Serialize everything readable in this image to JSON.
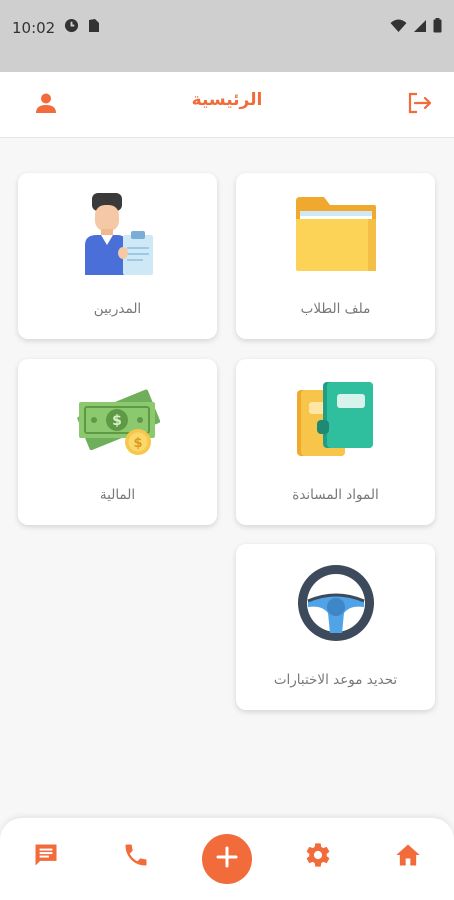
{
  "status_bar": {
    "time": "10:02",
    "icons": [
      "data-saver-icon",
      "sim-card-icon",
      "wifi-icon",
      "cell-signal-icon",
      "battery-icon"
    ]
  },
  "header": {
    "title": "الرئيسية",
    "profile_icon": "person-icon",
    "logout_icon": "logout-icon"
  },
  "cards": [
    {
      "id": "students",
      "label": "ملف الطلاب",
      "icon": "folder-icon"
    },
    {
      "id": "trainers",
      "label": "المدربين",
      "icon": "trainer-icon"
    },
    {
      "id": "materials",
      "label": "المواد المساندة",
      "icon": "books-icon"
    },
    {
      "id": "finance",
      "label": "المالية",
      "icon": "money-icon"
    },
    {
      "id": "exams",
      "label": "تحديد موعد الاختبارات",
      "icon": "steering-wheel-icon"
    }
  ],
  "bottom_nav": {
    "items": [
      "chat-icon",
      "phone-icon",
      "add-icon",
      "settings-icon",
      "home-icon"
    ]
  },
  "colors": {
    "accent": "#f26b3a",
    "status_bar_bg": "#cfcfcf",
    "page_bg": "#f7f7f7",
    "card_bg": "#ffffff",
    "label_text": "#777777"
  }
}
